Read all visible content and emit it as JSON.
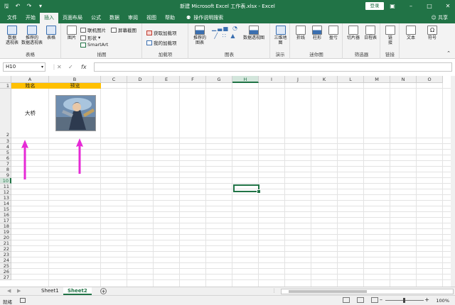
{
  "window": {
    "title": "新建 Microsoft Excel 工作表.xlsx  -  Excel",
    "login": "登录",
    "share": "共享",
    "tell_me": "操作说明搜索"
  },
  "menu_tabs": [
    "文件",
    "开始",
    "插入",
    "页面布局",
    "公式",
    "数据",
    "审阅",
    "视图",
    "帮助"
  ],
  "ribbon": {
    "groups": {
      "tables": "表格",
      "illustrations": "插图",
      "addins": "加载项",
      "charts": "图表",
      "tours": "演示",
      "sparklines": "迷你图",
      "filters": "筛选器",
      "links": "链接"
    },
    "buttons": {
      "pivot": "数据\n透视表",
      "recommended_pivot": "推荐的\n数据透视表",
      "table": "表格",
      "pictures": "图片",
      "online_pictures": "联机图片",
      "shapes": "形状",
      "smartart": "SmartArt",
      "screenshot": "屏幕截图",
      "get_addins": "获取加载项",
      "my_addins": "我的加载项",
      "recommended_charts": "推荐的\n图表",
      "pivot_chart": "数据透视图",
      "map_3d": "三维地\n图",
      "line": "折线",
      "column": "柱形",
      "winloss": "盈亏",
      "slicer": "切片器",
      "timeline": "日程表",
      "link": "链\n接",
      "text": "文本",
      "symbol": "符号"
    }
  },
  "formula_bar": {
    "name_box": "H10",
    "fx": "fx",
    "value": ""
  },
  "sheet": {
    "columns": [
      "A",
      "B",
      "C",
      "D",
      "E",
      "F",
      "G",
      "H",
      "I",
      "J",
      "K",
      "L",
      "M",
      "N",
      "O"
    ],
    "rows": [
      "1",
      "2",
      "3",
      "4",
      "5",
      "6",
      "7",
      "8",
      "9",
      "10",
      "11",
      "12",
      "13",
      "14",
      "15",
      "16",
      "17",
      "18",
      "19",
      "20",
      "21",
      "22",
      "23",
      "24",
      "25",
      "26",
      "27"
    ],
    "header_a": "姓名",
    "header_b": "预览",
    "cell_a2": "大桥",
    "header_fill": "#ffc000",
    "arrow_color": "#e62ad6",
    "selected_cell": "H10"
  },
  "sheet_tabs": [
    "Sheet1",
    "Sheet2"
  ],
  "active_sheet": "Sheet2",
  "status": {
    "ready": "就绪",
    "zoom": "100%"
  },
  "theme": {
    "accent": "#217346"
  }
}
